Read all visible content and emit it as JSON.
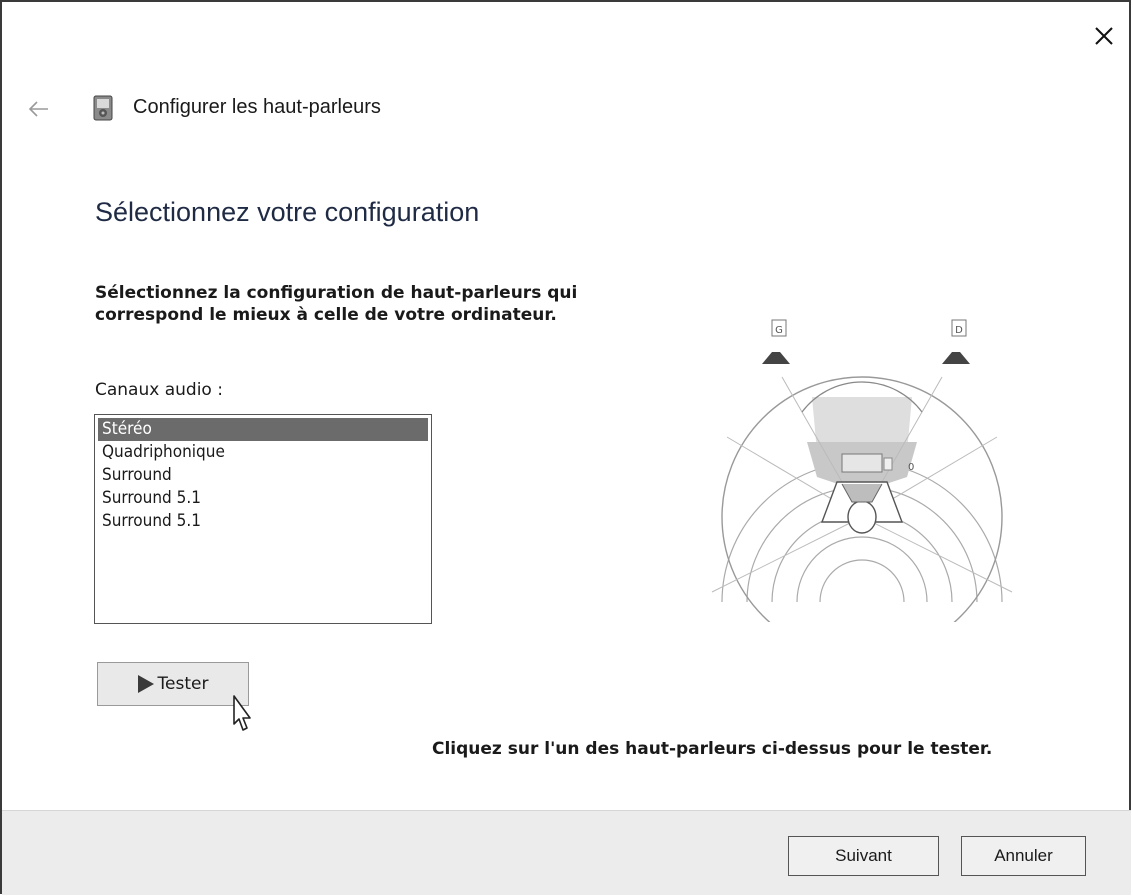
{
  "window": {
    "title": "Configurer les haut-parleurs",
    "close_label": "✕"
  },
  "page": {
    "heading": "Sélectionnez votre configuration",
    "instructions": "Sélectionnez la configuration de haut-parleurs qui correspond le mieux à celle de votre ordinateur.",
    "channels_label": "Canaux audio :"
  },
  "channels": {
    "items": [
      "Stéréo",
      "Quadriphonique",
      "Surround",
      "Surround 5.1",
      "Surround 5.1"
    ],
    "selected_index": 0
  },
  "buttons": {
    "test": "Tester",
    "next": "Suivant",
    "cancel": "Annuler"
  },
  "hint": "Cliquez sur l'un des haut-parleurs ci-dessus pour le tester.",
  "diagram": {
    "left_speaker_label": "G",
    "right_speaker_label": "D",
    "center_label": "0"
  },
  "icons": {
    "back": "back-arrow-icon",
    "header": "speaker-config-icon",
    "close": "close-icon",
    "play": "play-icon",
    "cursor": "mouse-pointer-icon"
  },
  "colors": {
    "selected_item": "#6b6b6b",
    "footer": "#ececec"
  }
}
